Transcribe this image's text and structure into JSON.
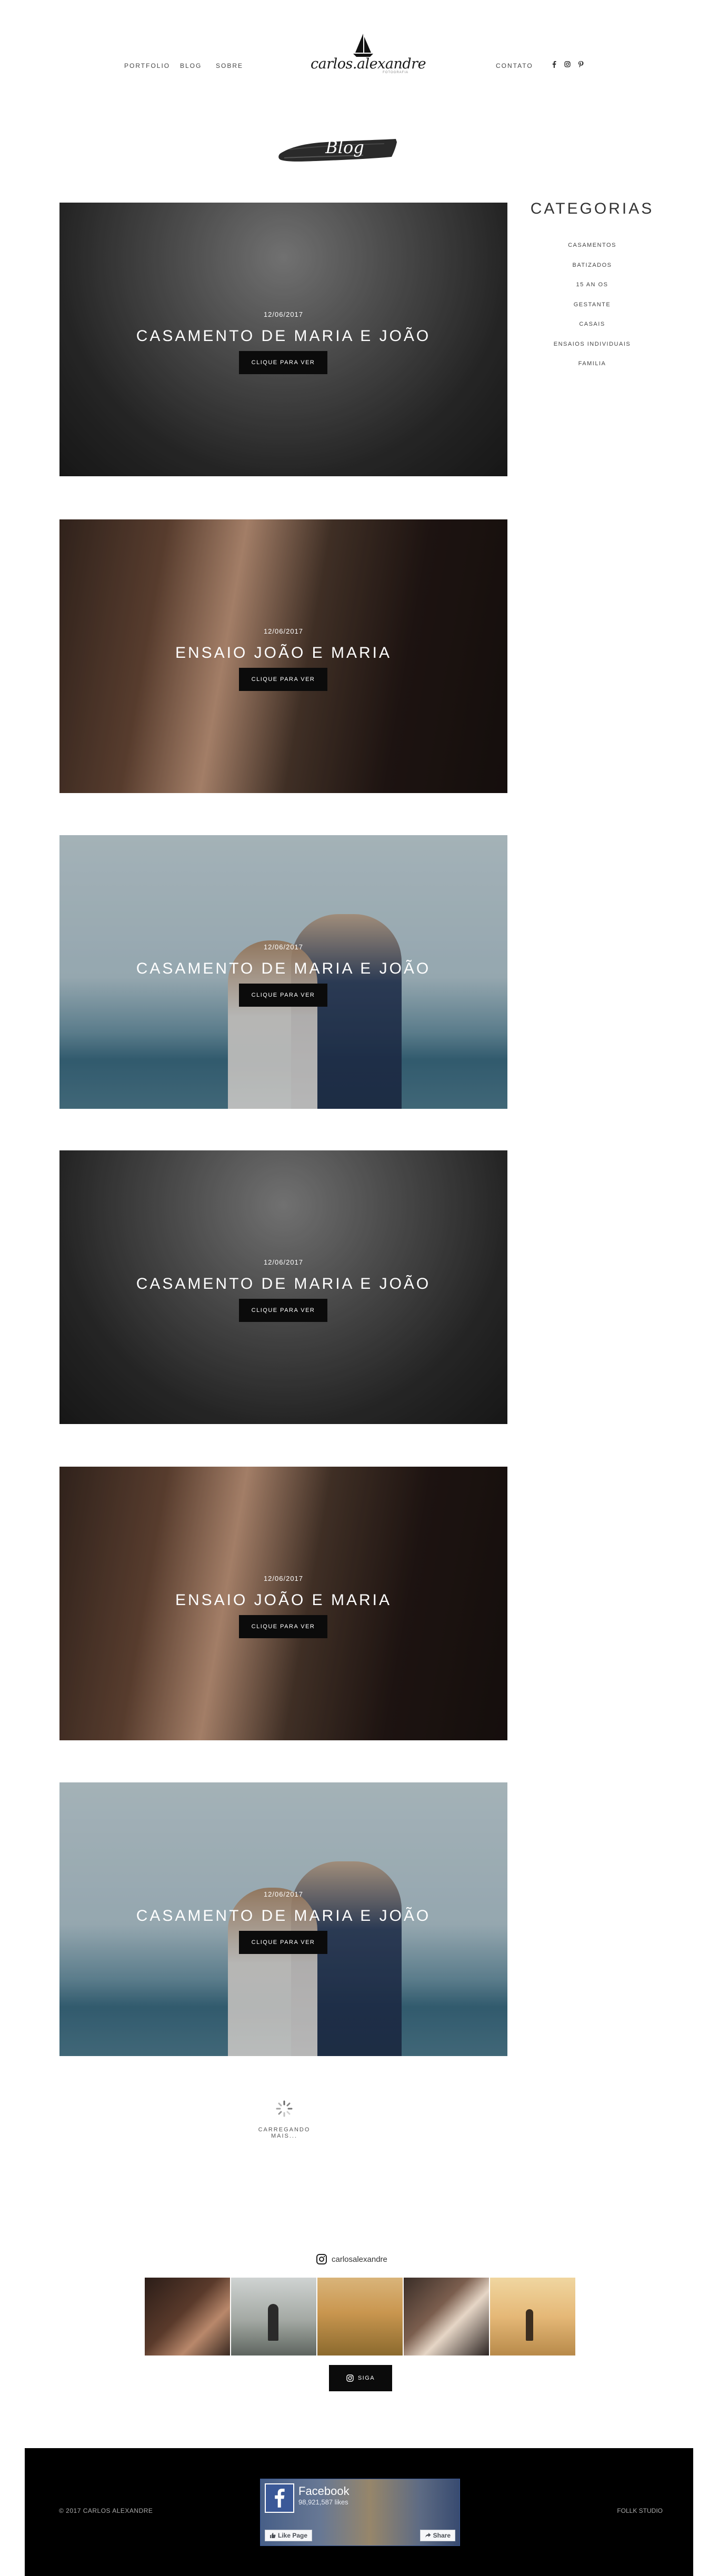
{
  "header": {
    "nav_left": [
      "PORTFOLIO",
      "BLOG",
      "SOBRE"
    ],
    "nav_right": [
      "CONTATO"
    ],
    "logo_text": "carlos.alexandre",
    "logo_subtext": "FOTOGRAFIA",
    "social_icons": [
      "facebook-icon",
      "instagram-icon",
      "pinterest-icon"
    ]
  },
  "blog_badge": "Blog",
  "posts": [
    {
      "date": "12/06/2017",
      "title": "CASAMENTO DE MARIA E JOÃO",
      "button": "CLIQUE PARA VER",
      "image": "groom-bw"
    },
    {
      "date": "12/06/2017",
      "title": "ENSAIO JOÃO E MARIA",
      "button": "CLIQUE PARA VER",
      "image": "couple-warm"
    },
    {
      "date": "12/06/2017",
      "title": "CASAMENTO DE MARIA E JOÃO",
      "button": "CLIQUE PARA VER",
      "image": "beach-wedding"
    },
    {
      "date": "12/06/2017",
      "title": "CASAMENTO DE MARIA E JOÃO",
      "button": "CLIQUE PARA VER",
      "image": "groom-bw"
    },
    {
      "date": "12/06/2017",
      "title": "ENSAIO JOÃO E MARIA",
      "button": "CLIQUE PARA VER",
      "image": "couple-warm"
    },
    {
      "date": "12/06/2017",
      "title": "CASAMENTO DE MARIA E JOÃO",
      "button": "CLIQUE PARA VER",
      "image": "beach-wedding"
    }
  ],
  "sidebar": {
    "title": "CATEGORIAS",
    "categories": [
      "CASAMENTOS",
      "BATIZADOS",
      "15 AN OS",
      "GESTANTE",
      "CASAIS",
      "ENSAIOS INDIVIDUAIS",
      "FAMILIA"
    ]
  },
  "loader": {
    "text": "CARREGANDO MAIS..."
  },
  "instagram": {
    "handle": "carlosalexandre",
    "follow_label": "SIGA"
  },
  "footer": {
    "copyright": "© 2017 CARLOS ALEXANDRE",
    "credit": "FOLLK STUDIO",
    "facebook": {
      "page_name": "Facebook",
      "likes": "98,921,587 likes",
      "like_button": "Like Page",
      "share_button": "Share"
    }
  },
  "colors": {
    "accent": "#0b0b0b",
    "footer_bg": "#000000",
    "facebook_blue": "#3b5998"
  }
}
